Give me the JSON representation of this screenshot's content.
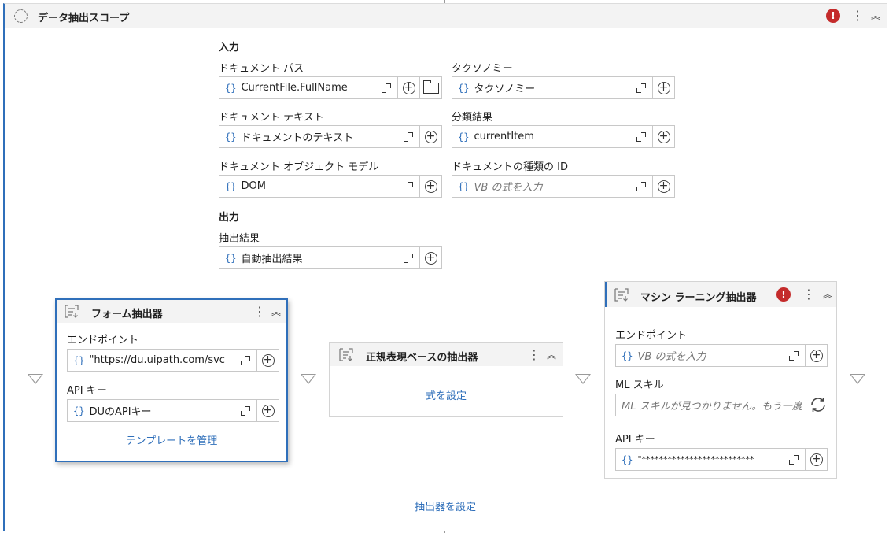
{
  "scope": {
    "title": "データ抽出スコープ",
    "error_badge": "!",
    "inputs_heading": "入力",
    "outputs_heading": "出力",
    "fields": {
      "document_path": {
        "label": "ドキュメント パス",
        "value": "CurrentFile.FullName"
      },
      "taxonomy": {
        "label": "タクソノミー",
        "value": "タクソノミー"
      },
      "document_text": {
        "label": "ドキュメント テキスト",
        "value": "ドキュメントのテキスト"
      },
      "classification_result": {
        "label": "分類結果",
        "value": "currentItem"
      },
      "document_object_model": {
        "label": "ドキュメント オブジェクト モデル",
        "value": "DOM"
      },
      "document_type_id": {
        "label": "ドキュメントの種類の ID",
        "placeholder": "VB の式を入力"
      },
      "extraction_result": {
        "label": "抽出結果",
        "value": "自動抽出結果"
      }
    },
    "configure_extractors_link": "抽出器を設定"
  },
  "form_extractor": {
    "title": "フォーム抽出器",
    "endpoint_label": "エンドポイント",
    "endpoint_value": "\"https://du.uipath.com/svc",
    "api_key_label": "API キー",
    "api_key_value": "DUのAPIキー",
    "manage_templates_link": "テンプレートを管理"
  },
  "regex_extractor": {
    "title": "正規表現ベースの抽出器",
    "configure_link": "式を設定"
  },
  "ml_extractor": {
    "title": "マシン ラーニング抽出器",
    "error_badge": "!",
    "endpoint_label": "エンドポイント",
    "endpoint_placeholder": "VB の式を入力",
    "ml_skill_label": "ML スキル",
    "ml_skill_placeholder": "ML スキルが見つかりません。もう一度お",
    "api_key_label": "API キー",
    "api_key_value": "\"**************************"
  },
  "icons": {
    "expression": "{}",
    "add": "+",
    "more": "⋮",
    "collapse": "︽"
  },
  "colors": {
    "accent": "#2f6fba",
    "error": "#c42b2b",
    "header_bg": "#f3f3f3"
  }
}
